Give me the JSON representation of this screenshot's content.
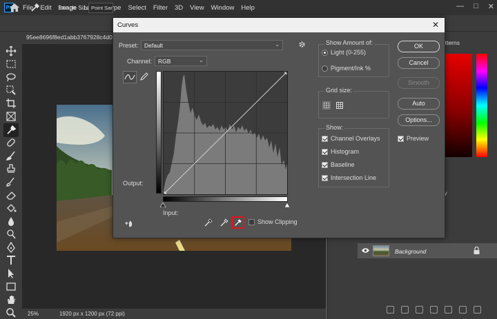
{
  "menubar": {
    "logo": "Ps",
    "items": [
      "File",
      "Edit",
      "Image",
      "Layer",
      "Type",
      "Select",
      "Filter",
      "3D",
      "View",
      "Window",
      "Help"
    ]
  },
  "options_bar": {
    "sample_size_label": "Sample Size:",
    "sample_size_value": "Point San"
  },
  "document": {
    "tab_title": "95ee8696f8ed1abb3767928c4d0c",
    "zoom": "25%",
    "doc_size": "1920 px x 1200 px (72 ppi)"
  },
  "panels": {
    "patterns_tab": "atterns",
    "history_tab": "ory",
    "layer_name": "Background"
  },
  "dialog": {
    "title": "Curves",
    "close_glyph": "✕",
    "preset_label": "Preset:",
    "preset_value": "Default",
    "channel_label": "Channel:",
    "channel_value": "RGB",
    "output_label": "Output:",
    "input_label": "Input:",
    "show_clipping_label": "Show Clipping",
    "show_amount": {
      "title": "Show Amount of:",
      "light_label": "Light  (0-255)",
      "pigment_label": "Pigment/Ink %",
      "selected": "light"
    },
    "grid_size_title": "Grid size:",
    "show": {
      "title": "Show:",
      "overlays": "Channel Overlays",
      "histogram": "Histogram",
      "baseline": "Baseline",
      "intersection": "Intersection Line"
    },
    "buttons": {
      "ok": "OK",
      "cancel": "Cancel",
      "smooth": "Smooth",
      "auto": "Auto",
      "options": "Options..."
    },
    "preview_label": "Preview",
    "highlight_color": "#e0161e"
  }
}
